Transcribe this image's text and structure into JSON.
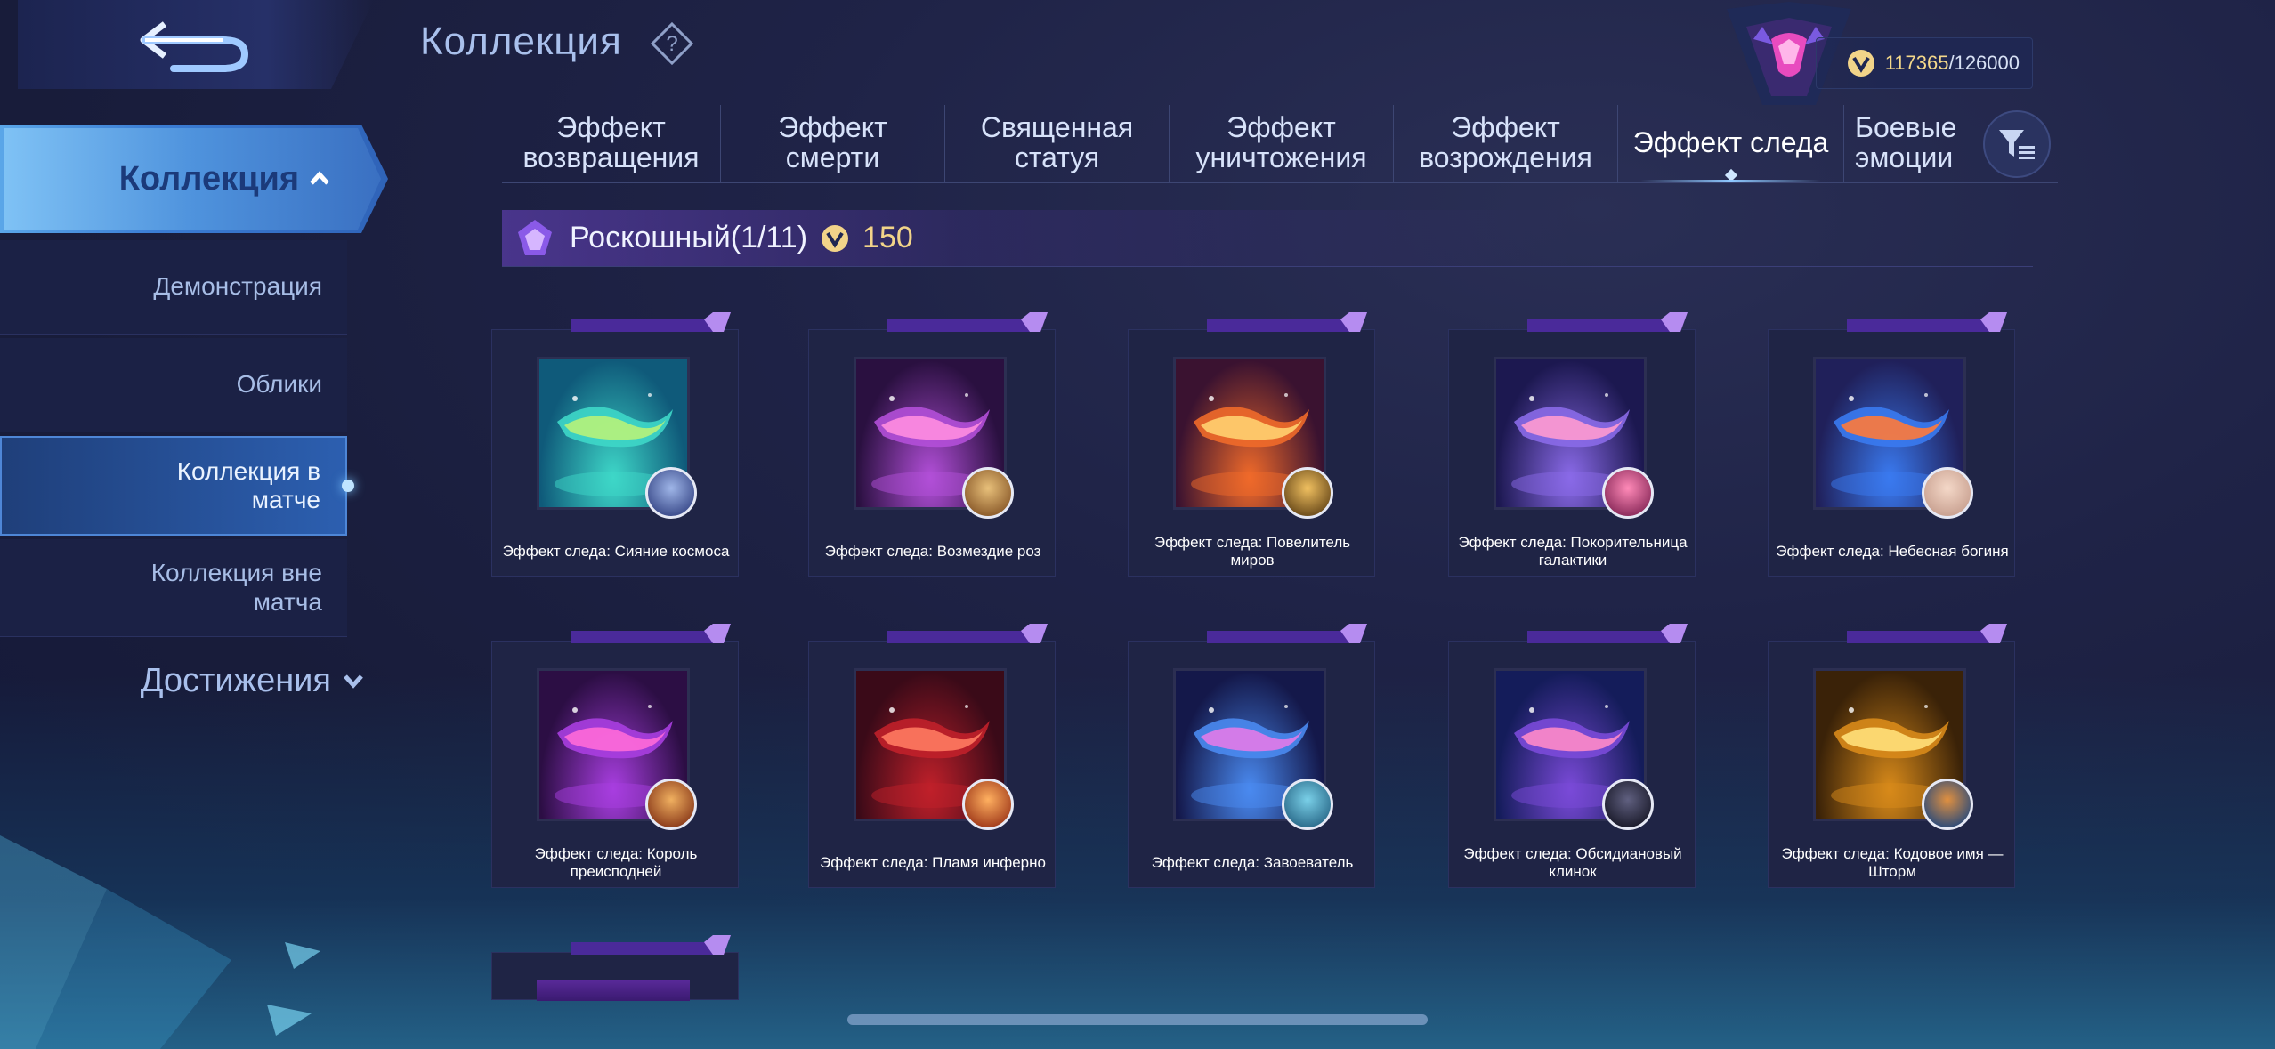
{
  "header": {
    "title": "Коллекция",
    "currency": {
      "current": "117365",
      "max": "/126000"
    }
  },
  "sidebar": {
    "main_label": "Коллекция",
    "items": [
      {
        "label": "Демонстрация"
      },
      {
        "label": "Облики"
      },
      {
        "label": "Коллекция в матче"
      },
      {
        "label": "Коллекция вне матча"
      }
    ],
    "achievements_label": "Достижения"
  },
  "tabs": [
    {
      "label": "Эффект возвращения"
    },
    {
      "label": "Эффект смерти"
    },
    {
      "label": "Священная статуя"
    },
    {
      "label": "Эффект уничтожения"
    },
    {
      "label": "Эффект возрождения"
    },
    {
      "label": "Эффект следа"
    },
    {
      "label": "Боевые эмоции"
    }
  ],
  "active_tab_index": 5,
  "section": {
    "title": "Роскошный(1/11)",
    "cost": "150"
  },
  "cards": [
    {
      "label": "Эффект следа: Сияние космоса",
      "colors": [
        "#0f5a7a",
        "#3ed7c8",
        "#b7f27a"
      ]
    },
    {
      "label": "Эффект следа: Возмездие роз",
      "colors": [
        "#2a1040",
        "#b24fd8",
        "#ff8de0"
      ]
    },
    {
      "label": "Эффект следа: Повелитель миров",
      "colors": [
        "#3a1230",
        "#f06a2a",
        "#ffd070"
      ]
    },
    {
      "label": "Эффект следа: Покорительница галактики",
      "colors": [
        "#1c1850",
        "#8a6ae8",
        "#ff9ad0"
      ]
    },
    {
      "label": "Эффект следа: Небесная богиня",
      "colors": [
        "#20205a",
        "#3a7af0",
        "#ff7a3a"
      ]
    },
    {
      "label": "Эффект следа: Король преисподней",
      "colors": [
        "#2c0e44",
        "#a83ee0",
        "#ff6ad8"
      ]
    },
    {
      "label": "Эффект следа: Пламя инферно",
      "colors": [
        "#3a0a18",
        "#c0202a",
        "#ff7a60"
      ]
    },
    {
      "label": "Эффект следа: Завоеватель",
      "colors": [
        "#14184a",
        "#4a8af0",
        "#e27ae8"
      ]
    },
    {
      "label": "Эффект следа: Обсидиановый клинок",
      "colors": [
        "#141c5a",
        "#7a4ad8",
        "#ff8ac8"
      ]
    },
    {
      "label": "Эффект следа: Кодовое имя — Шторм",
      "colors": [
        "#3a2208",
        "#d88a1a",
        "#ffe07a"
      ]
    }
  ]
}
